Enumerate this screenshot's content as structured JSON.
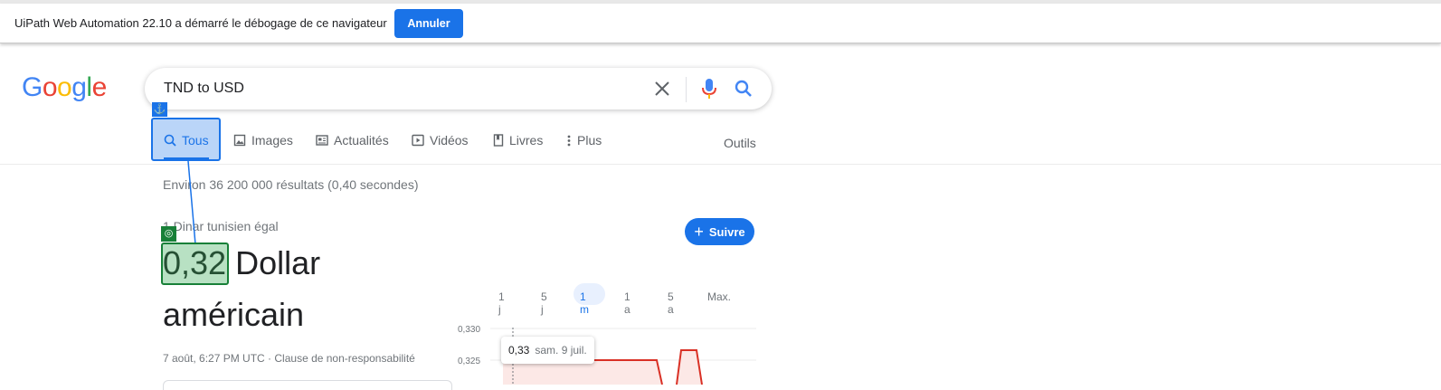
{
  "infobar": {
    "message": "UiPath Web Automation 22.10 a démarré le débogage de ce navigateur",
    "cancel_label": "Annuler"
  },
  "logo": {
    "letters": [
      "G",
      "o",
      "o",
      "g",
      "l",
      "e"
    ],
    "colors": [
      "#4285f4",
      "#ea4335",
      "#fbbc05",
      "#4285f4",
      "#34a853",
      "#ea4335"
    ]
  },
  "search": {
    "query": "TND to USD"
  },
  "tabs": [
    {
      "label": "Tous",
      "icon": "search-icon",
      "active": true
    },
    {
      "label": "Images",
      "icon": "image-icon"
    },
    {
      "label": "Actualités",
      "icon": "news-icon"
    },
    {
      "label": "Vidéos",
      "icon": "video-icon"
    },
    {
      "label": "Livres",
      "icon": "book-icon"
    },
    {
      "label": "Plus",
      "icon": "more-vert-icon"
    }
  ],
  "tools_label": "Outils",
  "results": {
    "stats": "Environ 36 200 000 résultats (0,40 secondes)"
  },
  "currency": {
    "equal_label": "1 Dinar tunisien égal",
    "value": "0,32",
    "unit_line1": "Dollar",
    "unit_line2": "américain",
    "timestamp": "7 août, 6:27 PM UTC",
    "separator": " · ",
    "disclaimer": "Clause de non-responsabilité",
    "follow_label": "Suivre"
  },
  "range_tabs": [
    {
      "label": "1 j"
    },
    {
      "label": "5 j"
    },
    {
      "label": "1 m",
      "active": true
    },
    {
      "label": "1 a"
    },
    {
      "label": "5 a"
    },
    {
      "label": "Max."
    }
  ],
  "chart": {
    "y_ticks": [
      "0,330",
      "0,325"
    ],
    "tooltip_value": "0,33",
    "tooltip_date": "sam. 9 juil.",
    "line_color": "#d93025",
    "fill_color": "#fce8e6"
  },
  "overlays": {
    "anchor_symbol": "⚓",
    "target_symbol": "◎"
  }
}
